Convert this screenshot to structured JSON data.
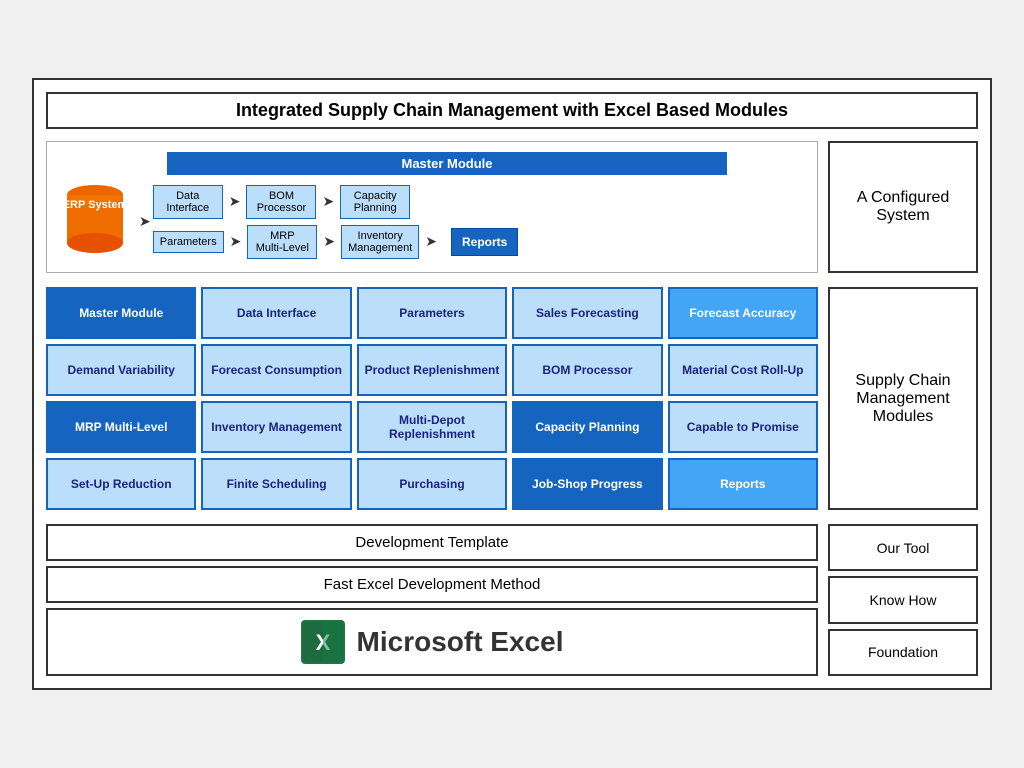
{
  "title": "Integrated Supply Chain Management with Excel Based Modules",
  "diagram": {
    "master_module_label": "Master Module",
    "erp_label": "ERP System",
    "nodes": [
      {
        "id": "data_interface",
        "label": "Data Interface"
      },
      {
        "id": "bom_processor_top",
        "label": "BOM Processor"
      },
      {
        "id": "capacity_planning_top",
        "label": "Capacity Planning"
      },
      {
        "id": "parameters",
        "label": "Parameters"
      },
      {
        "id": "mrp_multilevel_top",
        "label": "MRP Multi-Level"
      },
      {
        "id": "inventory_mgmt_top",
        "label": "Inventory Management"
      },
      {
        "id": "reports",
        "label": "Reports"
      }
    ]
  },
  "configured_label": "A Configured System",
  "modules": [
    {
      "label": "Master Module",
      "style": "dark"
    },
    {
      "label": "Data Interface",
      "style": "light"
    },
    {
      "label": "Parameters",
      "style": "light"
    },
    {
      "label": "Sales Forecasting",
      "style": "light"
    },
    {
      "label": "Forecast Accuracy",
      "style": "medium"
    },
    {
      "label": "Demand Variability",
      "style": "light"
    },
    {
      "label": "Forecast Consumption",
      "style": "light"
    },
    {
      "label": "Product Replenishment",
      "style": "light"
    },
    {
      "label": "BOM Processor",
      "style": "light"
    },
    {
      "label": "Material Cost Roll-Up",
      "style": "light"
    },
    {
      "label": "MRP Multi-Level",
      "style": "dark"
    },
    {
      "label": "Inventory Management",
      "style": "light"
    },
    {
      "label": "Multi-Depot Replenishment",
      "style": "light"
    },
    {
      "label": "Capacity Planning",
      "style": "dark"
    },
    {
      "label": "Capable to Promise",
      "style": "light"
    },
    {
      "label": "Set-Up Reduction",
      "style": "light"
    },
    {
      "label": "Finite Scheduling",
      "style": "light"
    },
    {
      "label": "Purchasing",
      "style": "light"
    },
    {
      "label": "Job-Shop Progress",
      "style": "dark"
    },
    {
      "label": "Reports",
      "style": "medium"
    }
  ],
  "supply_chain_label": "Supply Chain Management Modules",
  "bottom": {
    "dev_template": "Development Template",
    "fast_excel": "Fast Excel Development Method",
    "excel_text": "Microsoft Excel",
    "our_tool": "Our Tool",
    "know_how": "Know How",
    "foundation": "Foundation"
  }
}
